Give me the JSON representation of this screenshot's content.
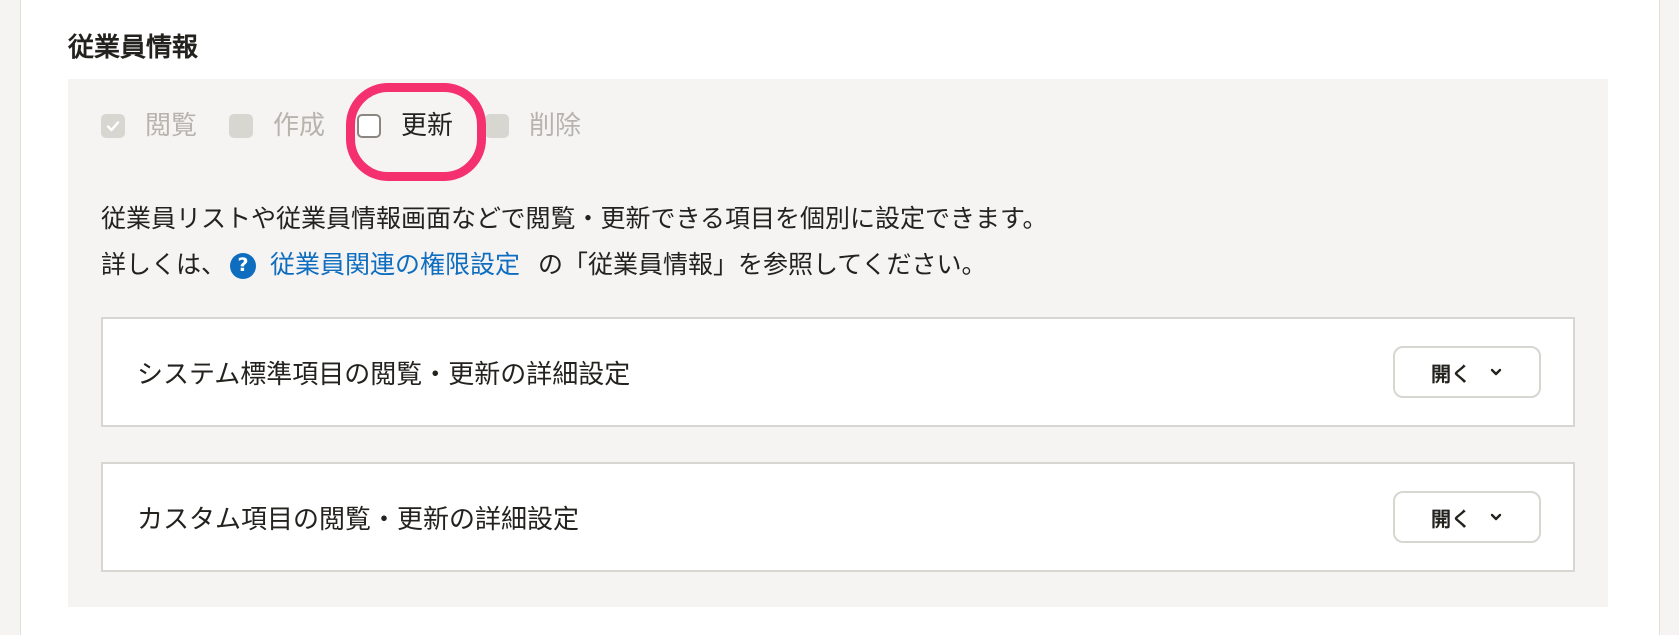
{
  "section": {
    "title": "従業員情報"
  },
  "permissions": [
    {
      "label": "閲覧",
      "checked": true,
      "disabled": true
    },
    {
      "label": "作成",
      "checked": false,
      "disabled": true
    },
    {
      "label": "更新",
      "checked": false,
      "disabled": false,
      "highlighted": true
    },
    {
      "label": "削除",
      "checked": false,
      "disabled": true
    }
  ],
  "description": {
    "line1": "従業員リストや従業員情報画面などで閲覧・更新できる項目を個別に設定できます。",
    "line2_prefix": "詳しくは、",
    "help_icon": "question-circle-icon",
    "link_text": "従業員関連の権限設定",
    "line2_suffix": "の「従業員情報」を参照してください。"
  },
  "accordions": [
    {
      "title": "システム標準項目の閲覧・更新の詳細設定",
      "button_label": "開く"
    },
    {
      "title": "カスタム項目の閲覧・更新の詳細設定",
      "button_label": "開く"
    }
  ],
  "colors": {
    "highlight": "#f4306f",
    "link": "#0f6dbf",
    "panel_bg": "#f5f4f2"
  }
}
